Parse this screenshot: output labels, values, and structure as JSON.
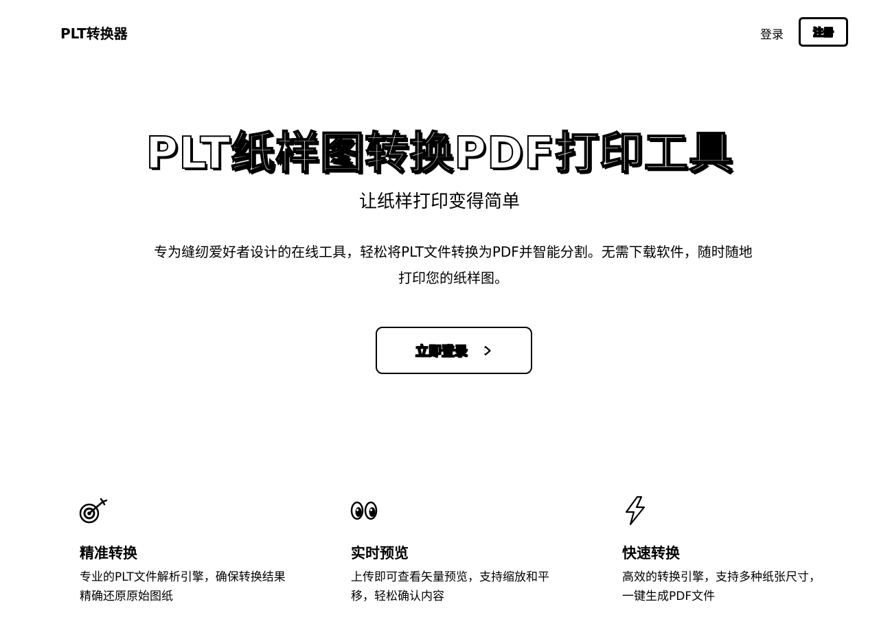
{
  "header": {
    "brand": "PLT转换器",
    "login_label": "登录",
    "register_label": "注册"
  },
  "hero": {
    "title": "PLT纸样图转换PDF打印工具",
    "subtitle": "让纸样打印变得简单",
    "description": "专为缝纫爱好者设计的在线工具，轻松将PLT文件转换为PDF并智能分割。无需下载软件，随时随地打印您的纸样图。",
    "cta_label": "立即登录"
  },
  "features": [
    {
      "icon": "target-icon",
      "title": "精准转换",
      "description": "专业的PLT文件解析引擎，确保转换结果精确还原原始图纸"
    },
    {
      "icon": "eyes-icon",
      "title": "实时预览",
      "description": "上传即可查看矢量预览，支持缩放和平移，轻松确认内容"
    },
    {
      "icon": "lightning-icon",
      "title": "快速转换",
      "description": "高效的转换引擎，支持多种纸张尺寸，一键生成PDF文件"
    }
  ]
}
